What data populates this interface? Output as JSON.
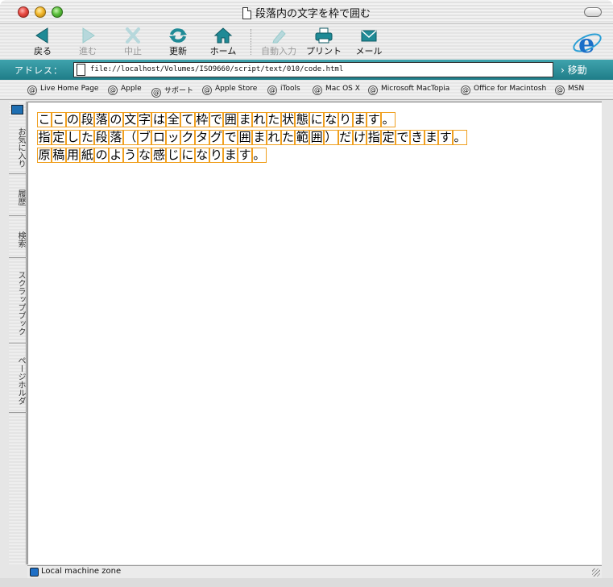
{
  "window": {
    "title": "段落内の文字を枠で囲む"
  },
  "toolbar": {
    "back": "戻る",
    "forward": "進む",
    "stop": "中止",
    "refresh": "更新",
    "home": "ホーム",
    "autofill": "自動入力",
    "print": "プリント",
    "mail": "メール"
  },
  "address": {
    "label": "アドレス：",
    "url": "file://localhost/Volumes/ISO9660/script/text/010/code.html",
    "go": "移動"
  },
  "favorites": [
    "Live Home Page",
    "Apple",
    "サポート",
    "Apple Store",
    "iTools",
    "Mac OS X",
    "Microsoft MacTopia",
    "Office for Macintosh",
    "MSN"
  ],
  "sidebar_tabs": [
    "お気に入り",
    "履歴",
    "検索",
    "スクラップブック",
    "ページホルダ"
  ],
  "content": {
    "lines": [
      "ここの段落の文字は全て枠で囲まれた状態になります。",
      "指定した段落（ブロックタグで囲まれた範囲）だけ指定できます。",
      "原稿用紙のような感じになります。"
    ]
  },
  "status": {
    "zone": "Local machine zone"
  },
  "colors": {
    "char_border": "#f0a020",
    "address_bar": "#2a8d98",
    "icon_teal": "#1f8a96"
  }
}
